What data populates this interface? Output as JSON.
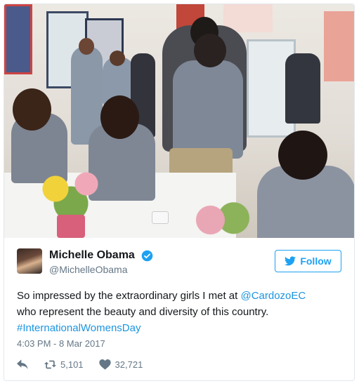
{
  "tweet": {
    "author_name": "Michelle Obama",
    "author_handle": "@MichelleObama",
    "follow_label": "Follow",
    "text_line1": "So impressed by the extraordinary girls I met at ",
    "mention": "@CardozoEC",
    "text_line2": "who represent the beauty and diversity of this country.",
    "hashtag": "#InternationalWomensDay",
    "timestamp": "4:03 PM - 8 Mar 2017",
    "retweet_count": "5,101",
    "like_count": "32,721"
  },
  "colors": {
    "accent": "#1da1f2",
    "link": "#1b95e0",
    "muted": "#657786"
  },
  "icons": {
    "verified": "verified-badge-icon",
    "follow": "twitter-bird-icon",
    "reply": "reply-arrow-icon",
    "retweet": "retweet-icon",
    "like": "heart-icon"
  }
}
